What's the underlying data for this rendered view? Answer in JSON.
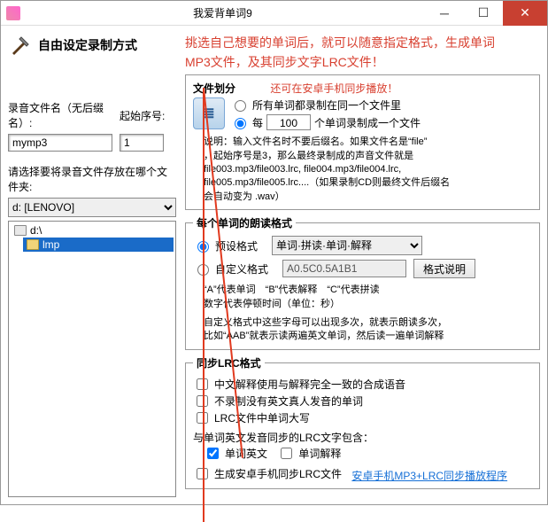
{
  "window": {
    "title": "我爱背单词9"
  },
  "header": {
    "left_title": "自由设定录制方式",
    "red_line1": "挑选自己想要的单词后，就可以随意指定格式，生成单词",
    "red_line2": "MP3文件，及其同步文字LRC文件！",
    "red_line3": "还可在安卓手机同步播放！"
  },
  "left": {
    "filename_label": "录音文件名（无后缀名）:",
    "filename_value": "mymp3",
    "startnum_label": "起始序号:",
    "startnum_value": "1",
    "save_label": "请选择要将录音文件存放在哪个文件夹:",
    "drive_value": "d: [LENOVO]",
    "tree": {
      "root": "d:\\",
      "child": "lmp"
    }
  },
  "filesplit": {
    "legend": "文件划分",
    "opt_all": "所有单词都录制在同一个文件里",
    "opt_each_pre": "每",
    "opt_each_count": "100",
    "opt_each_post": "个单词录制成一个文件",
    "desc1": "说明：输入文件名时不要后缀名。如果文件名是“file”",
    "desc2": "，起始序号是3，那么最终录制成的声音文件就是",
    "desc3": "file003.mp3/file003.lrc, file004.mp3/file004.lrc,",
    "desc4": "file005.mp3/file005.lrc....（如果录制CD则最终文件后缀名",
    "desc5": "会自动变为 .wav）"
  },
  "readfmt": {
    "legend": "每个单词的朗读格式",
    "preset_label": "预设格式",
    "preset_value": "单词·拼读·单词·解释",
    "custom_label": "自定义格式",
    "custom_value": "A0.5C0.5A1B1",
    "btn_desc": "格式说明",
    "note1": "“A”代表单词　“B”代表解释　“C”代表拼读",
    "note2": "数字代表停顿时间（单位：秒）",
    "note3": "自定义格式中这些字母可以出现多次，就表示朗读多次，",
    "note4": "比如“AAB”就表示读两遍英文单词，然后读一遍单词解释"
  },
  "lrc": {
    "legend": "同步LRC格式",
    "opt1": "中文解释使用与解释完全一致的合成语音",
    "opt2": "不录制没有英文真人发音的单词",
    "opt3": "LRC文件中单词大写",
    "sync_label": "与单词英文发音同步的LRC文字包含：",
    "chk_word": "单词英文",
    "chk_expl": "单词解释",
    "gen_label": "生成安卓手机同步LRC文件",
    "link": "安卓手机MP3+LRC同步播放程序"
  }
}
